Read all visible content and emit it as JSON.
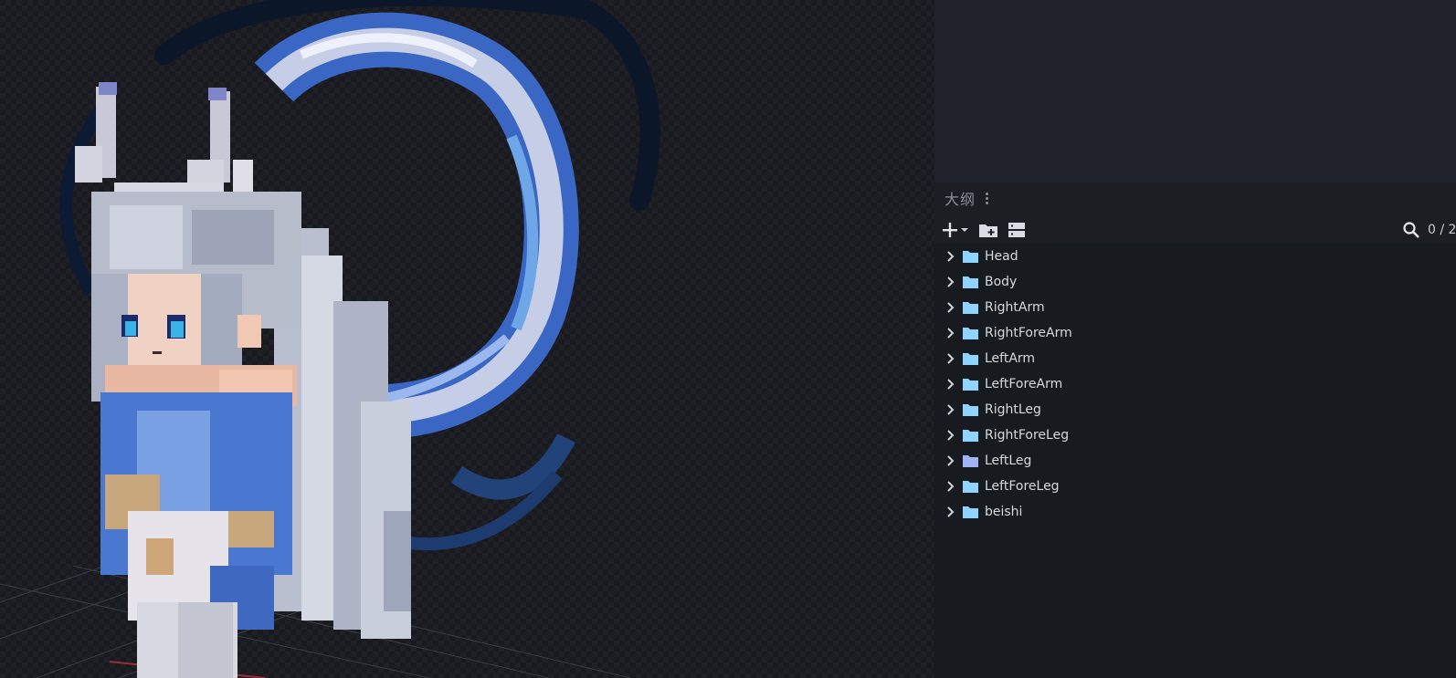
{
  "outliner": {
    "title": "大纲",
    "menu_icon": "dots-vertical-icon",
    "toolbar": {
      "add_icon": "plus-icon",
      "dropdown_icon": "caret-down-icon",
      "add_group_icon": "folder-plus-icon",
      "collapse_icon": "collapse-all-icon",
      "search_icon": "search-icon",
      "counter": "0 / 2"
    },
    "items": [
      {
        "label": "Head",
        "color": "#8fd3ff"
      },
      {
        "label": "Body",
        "color": "#8fd3ff"
      },
      {
        "label": "RightArm",
        "color": "#8fd3ff"
      },
      {
        "label": "RightForeArm",
        "color": "#8fd3ff"
      },
      {
        "label": "LeftArm",
        "color": "#8fd3ff"
      },
      {
        "label": "LeftForeArm",
        "color": "#8fd3ff"
      },
      {
        "label": "RightLeg",
        "color": "#8fd3ff"
      },
      {
        "label": "RightForeLeg",
        "color": "#8fd3ff"
      },
      {
        "label": "LeftLeg",
        "color": "#9fb3f5"
      },
      {
        "label": "LeftForeLeg",
        "color": "#8fd3ff"
      },
      {
        "label": "beishi",
        "color": "#8fd3ff"
      }
    ]
  },
  "colors": {
    "viewport_bg": "#181a1f",
    "panel_bg": "#1c1e24",
    "folder_icon": "#8fd3ff",
    "text": "#d6d9df"
  }
}
